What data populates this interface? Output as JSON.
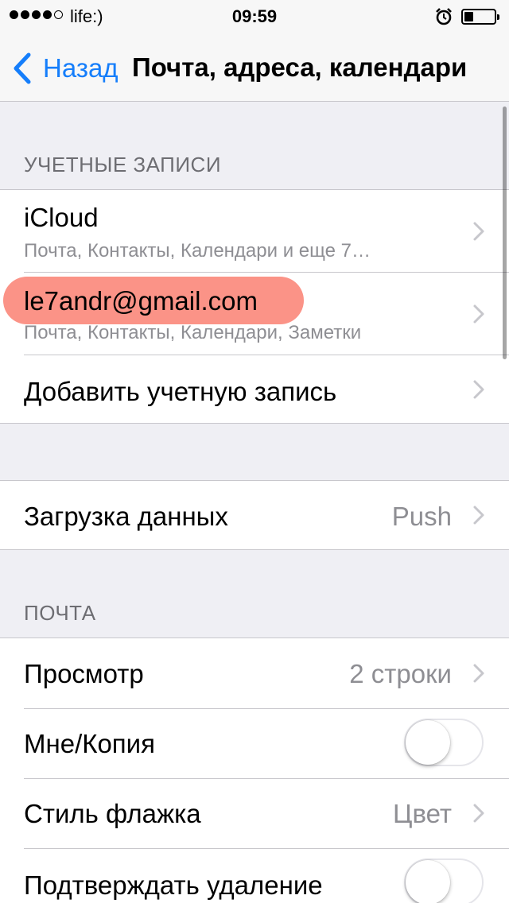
{
  "status_bar": {
    "signal_dots": [
      true,
      true,
      true,
      true,
      false
    ],
    "carrier": "life:)",
    "time": "09:59",
    "battery_level_percent": 30
  },
  "nav": {
    "back_label": "Назад",
    "title": "Почта, адреса, календари"
  },
  "accounts": {
    "header": "УЧЕТНЫЕ ЗАПИСИ",
    "items": [
      {
        "title": "iCloud",
        "subtitle": "Почта, Контакты, Календари и еще 7…"
      },
      {
        "title": "le7andr@gmail.com",
        "subtitle": "Почта, Контакты, Календари, Заметки",
        "highlighted": true
      },
      {
        "title": "Добавить учетную запись"
      }
    ]
  },
  "fetch": {
    "title": "Загрузка данных",
    "value": "Push"
  },
  "mail": {
    "header": "ПОЧТА",
    "items": [
      {
        "title": "Просмотр",
        "value": "2 строки"
      },
      {
        "title": "Мне/Копия",
        "toggle_on": false
      },
      {
        "title": "Стиль флажка",
        "value": "Цвет"
      },
      {
        "title": "Подтверждать удаление",
        "toggle_on": false
      }
    ]
  },
  "colors": {
    "accent": "#157efb",
    "highlight": "#fa8072",
    "background": "#efeff4"
  }
}
